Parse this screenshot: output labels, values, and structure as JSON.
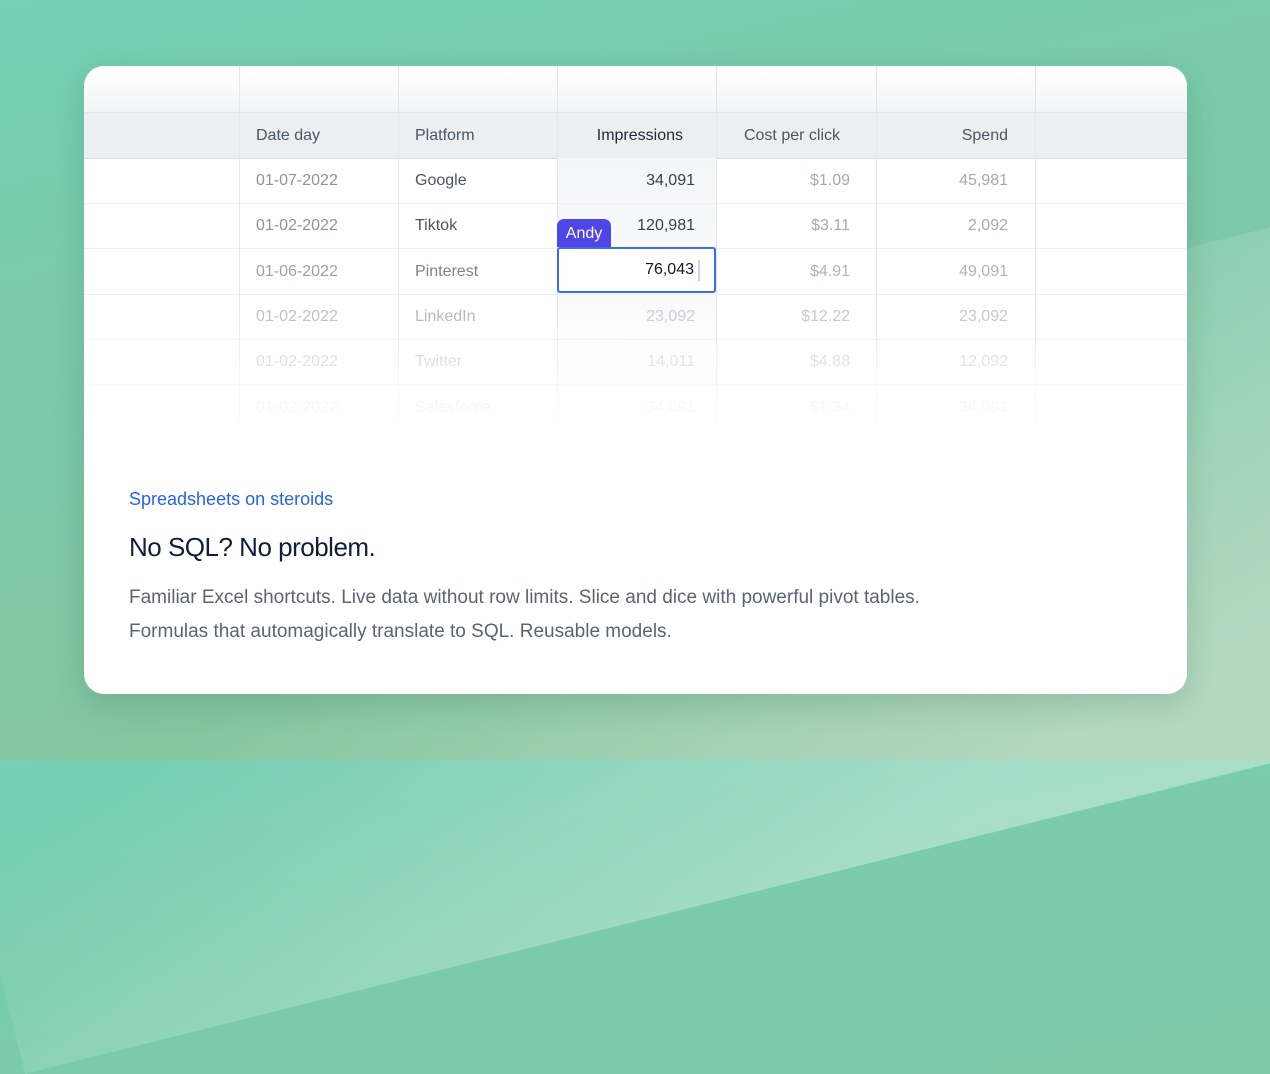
{
  "table": {
    "columns": [
      {
        "label": "Date day",
        "align": "left"
      },
      {
        "label": "Platform",
        "align": "left"
      },
      {
        "label": "Impressions",
        "align": "right"
      },
      {
        "label": "Cost per click",
        "align": "right"
      },
      {
        "label": "Spend",
        "align": "right"
      }
    ],
    "active_column": "Impressions",
    "rows": [
      {
        "date": "01-07-2022",
        "platform": "Google",
        "impressions": "34,091",
        "cpc": "$1.09",
        "spend": "45,981"
      },
      {
        "date": "01-02-2022",
        "platform": "Tiktok",
        "impressions": "120,981",
        "cpc": "$3.11",
        "spend": "2,092"
      },
      {
        "date": "01-06-2022",
        "platform": "Pinterest",
        "impressions": "76,043",
        "cpc": "$4.91",
        "spend": "49,091"
      },
      {
        "date": "01-02-2022",
        "platform": "LinkedIn",
        "impressions": "23,092",
        "cpc": "$12.22",
        "spend": "23,092"
      },
      {
        "date": "01-02-2022",
        "platform": "Twitter",
        "impressions": "14,011",
        "cpc": "$4.88",
        "spend": "12,092"
      },
      {
        "date": "01-02-2022",
        "platform": "Salesforce",
        "impressions": "34,091",
        "cpc": "$1.34",
        "spend": "34,091"
      }
    ]
  },
  "editing": {
    "user": "Andy",
    "value": "76,043",
    "tag_color": "#4f46e5",
    "border_color": "#3b6df0"
  },
  "feature": {
    "kicker": "Spreadsheets on steroids",
    "headline": "No SQL? No problem.",
    "description_line1": "Familiar Excel shortcuts. Live data without row limits. Slice and dice with powerful pivot tables.",
    "description_line2": "Formulas that automagically translate to SQL. Reusable models."
  },
  "colors": {
    "background_top": "#74cfb3",
    "background_bottom": "#8cc39b",
    "accent": "#2563eb"
  }
}
